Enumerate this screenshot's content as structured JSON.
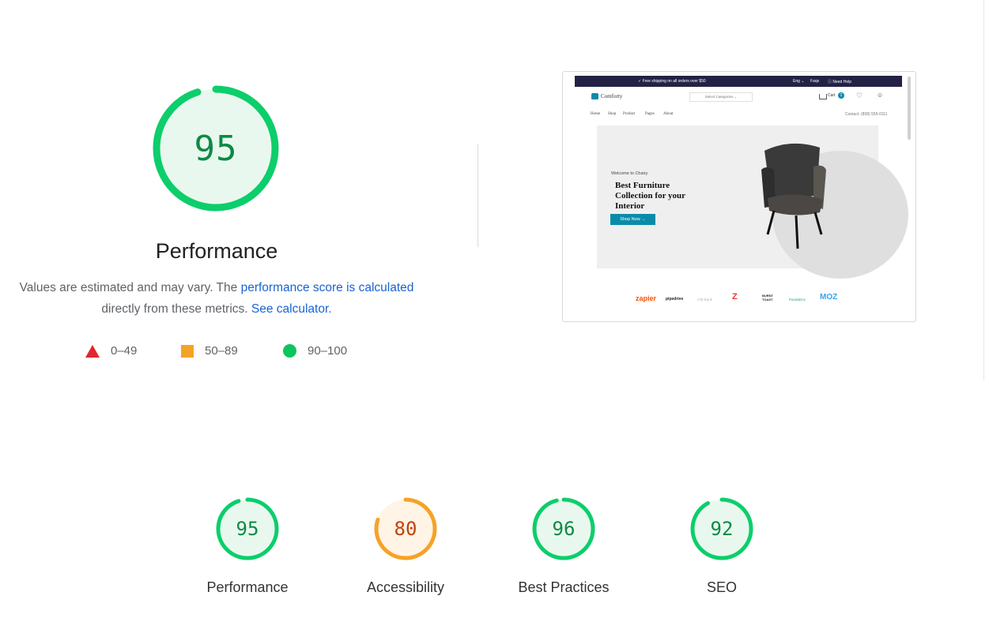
{
  "main_score": {
    "value": 95,
    "fraction": 0.95,
    "title": "Performance",
    "color": "#0cce6b",
    "fill": "#e9f8ef"
  },
  "note": {
    "text_before_link": "Values are estimated and may vary. The ",
    "link_score": "performance score is calculated",
    "text_middle": "directly from these metrics. ",
    "link_calculator": "See calculator."
  },
  "legend": [
    {
      "label": "0–49",
      "shape": "triangle",
      "color": "#e3262e"
    },
    {
      "label": "50–89",
      "shape": "square",
      "color": "#f6a228"
    },
    {
      "label": "90–100",
      "shape": "circle",
      "color": "#0bc55f"
    }
  ],
  "screenshot": {
    "topbar_shipping": "✓ Free shipping on all orders over $50",
    "topbar_lang": "Eng ⌄",
    "topbar_faqs": "Faqs",
    "topbar_help": "ⓘ Need Help",
    "logo": "Comforty",
    "category_select": "Select Categories ⌄",
    "cart_label": "Cart",
    "cart_count": "2",
    "nav": [
      "Home",
      "Shop",
      "Product",
      "Pages",
      "About"
    ],
    "contact": "Contact: (808) 555-0111",
    "hero_welcome": "Welcome to Chairy",
    "hero_heading": [
      "Best Furniture",
      "Collection for your",
      "Interior"
    ],
    "hero_button": "Shop Now →",
    "brands": [
      "zapier",
      "pipedrive",
      "CIB Bank",
      "Z",
      "BURNT TOAST",
      "PandaDoc",
      "MOZ"
    ]
  },
  "categories": [
    {
      "label": "Performance",
      "score": 95,
      "fraction": 0.95,
      "status": "pass"
    },
    {
      "label": "Accessibility",
      "score": 80,
      "fraction": 0.8,
      "status": "average"
    },
    {
      "label": "Best Practices",
      "score": 96,
      "fraction": 0.96,
      "status": "pass"
    },
    {
      "label": "SEO",
      "score": 92,
      "fraction": 0.92,
      "status": "pass"
    }
  ],
  "colors": {
    "pass_arc": "#0cce6b",
    "pass_fill": "#e9f8ef",
    "pass_text": "#0c8a45",
    "average_arc": "#f6a228",
    "average_fill": "#fff4e5",
    "average_text": "#c2410c",
    "link": "#1a63d1"
  }
}
